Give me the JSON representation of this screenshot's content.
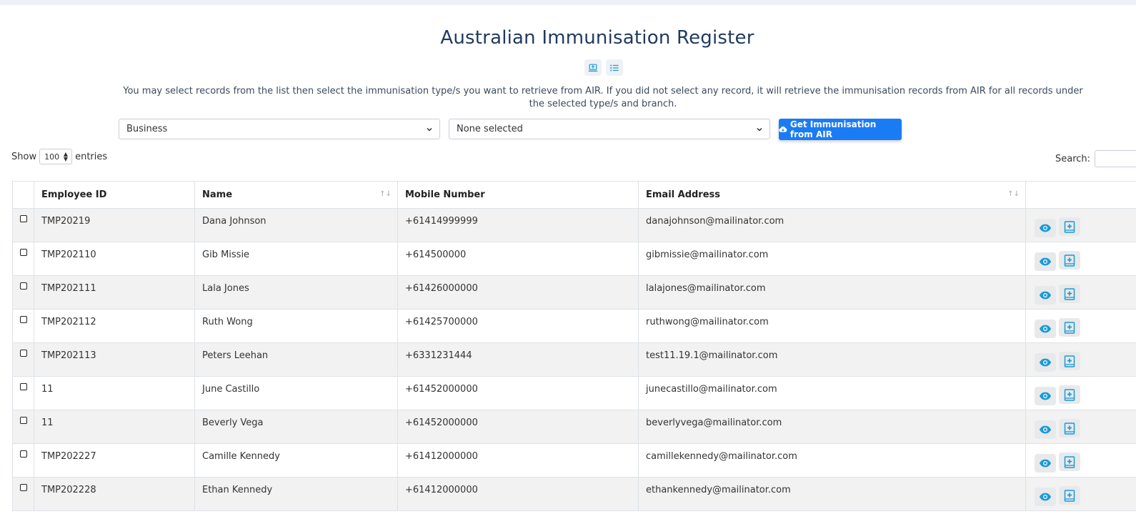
{
  "page": {
    "title": "Australian Immunisation Register",
    "description": "You may select records from the list then select the immunisation type/s you want to retrieve from AIR. If you did not select any record, it will retrieve the immunisation records from AIR for all records under the selected type/s and branch."
  },
  "filters": {
    "business_value": "Business",
    "type_value": "None selected",
    "air_button_label": "Get Immunisation from AIR"
  },
  "table_controls": {
    "show_label": "Show",
    "entries_value": "100",
    "entries_label": "entries",
    "search_label": "Search:"
  },
  "table": {
    "columns": [
      "Employee ID",
      "Name",
      "Mobile Number",
      "Email Address"
    ],
    "rows": [
      {
        "id": "TMP20219",
        "name": "Dana Johnson",
        "mobile": "+61414999999",
        "email": "danajohnson@mailinator.com"
      },
      {
        "id": "TMP202110",
        "name": "Gib Missie",
        "mobile": "+614500000",
        "email": "gibmissie@mailinator.com"
      },
      {
        "id": "TMP202111",
        "name": "Lala Jones",
        "mobile": "+61426000000",
        "email": "lalajones@mailinator.com"
      },
      {
        "id": "TMP202112",
        "name": "Ruth Wong",
        "mobile": "+61425700000",
        "email": "ruthwong@mailinator.com"
      },
      {
        "id": "TMP202113",
        "name": "Peters Leehan",
        "mobile": "+6331231444",
        "email": "test11.19.1@mailinator.com"
      },
      {
        "id": "11",
        "name": "June Castillo",
        "mobile": "+61452000000",
        "email": "junecastillo@mailinator.com"
      },
      {
        "id": "11",
        "name": "Beverly Vega",
        "mobile": "+61452000000",
        "email": "beverlyvega@mailinator.com"
      },
      {
        "id": "TMP202227",
        "name": "Camille Kennedy",
        "mobile": "+61412000000",
        "email": "camillekennedy@mailinator.com"
      },
      {
        "id": "TMP202228",
        "name": "Ethan Kennedy",
        "mobile": "+61412000000",
        "email": "ethankennedy@mailinator.com"
      }
    ]
  },
  "icons": {
    "view_icon": "eye-icon",
    "add_icon": "medical-book-plus-icon",
    "accent_color": "#1a9bd7",
    "primary_button_color": "#1a7cf5"
  }
}
